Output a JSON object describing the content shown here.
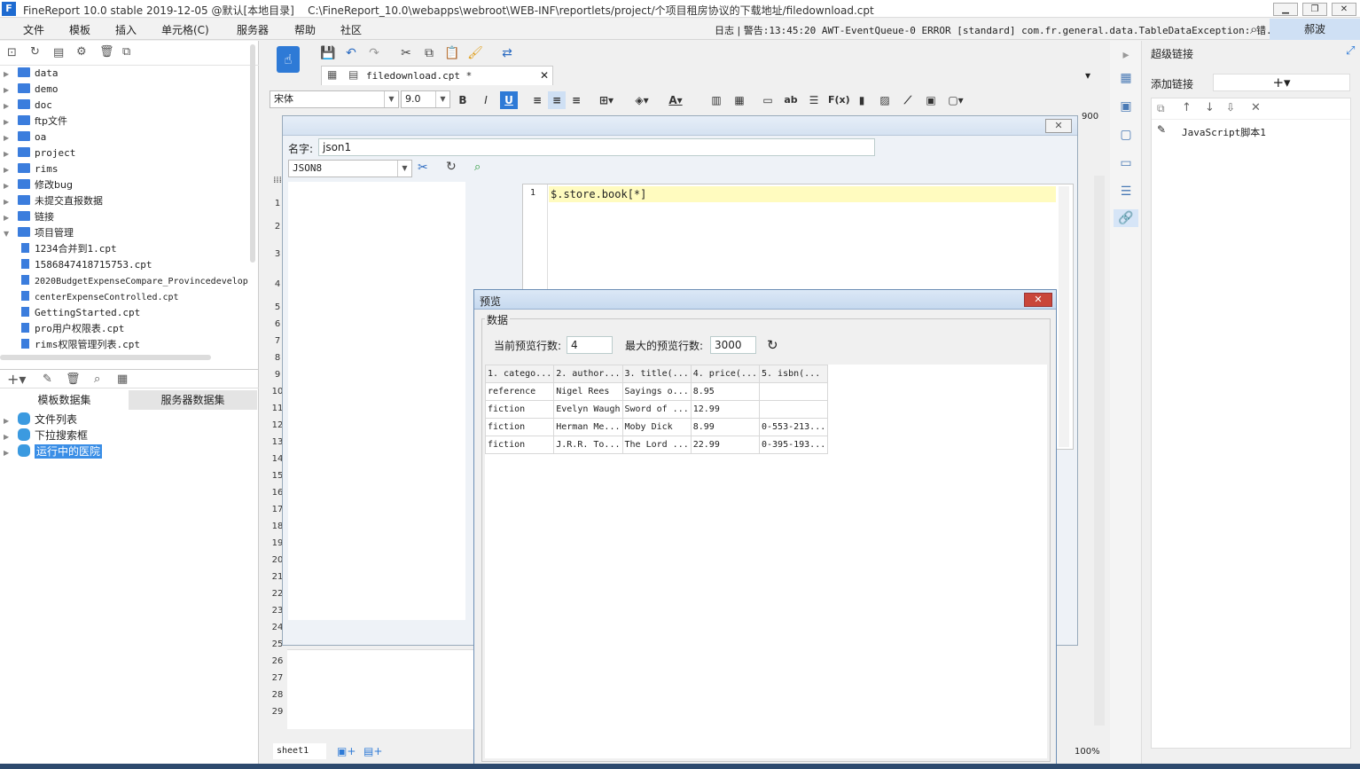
{
  "window": {
    "title": "FineReport 10.0 stable 2019-12-05 @默认[本地目录]",
    "path": "C:\\FineReport_10.0\\webapps\\webroot\\WEB-INF\\reportlets/project/个项目租房协议的下载地址/filedownload.cpt",
    "controls": [
      "▁",
      "❐",
      "✕"
    ]
  },
  "menu": {
    "items": [
      "文件",
      "模板",
      "插入",
      "单元格(C)",
      "服务器",
      "帮助",
      "社区"
    ],
    "log_label": "日志",
    "warning_text": "警告:13:45:20 AWT-EventQueue-0 ERROR [standard] com.fr.general.data.TableDataException: 错...",
    "user": "郝波"
  },
  "tree": {
    "folders": [
      "data",
      "demo",
      "doc",
      "ftp文件",
      "oa",
      "project",
      "rims",
      "修改bug",
      "未提交直报数据",
      "链接",
      "项目管理"
    ],
    "files": [
      "1234合并到1.cpt",
      "1586847418715753.cpt",
      "2020BudgetExpenseCompare_Provincedevelop",
      "centerExpenseControlled.cpt",
      "GettingStarted.cpt",
      "pro用户权限表.cpt",
      "rims权限管理列表.cpt"
    ]
  },
  "dataset_tabs": {
    "template": "模板数据集",
    "server": "服务器数据集"
  },
  "datasets": [
    "文件列表",
    "下拉搜索框",
    "运行中的医院"
  ],
  "editor": {
    "tab_name": "filedownload.cpt *",
    "font_name": "宋体",
    "font_size": "9.0",
    "ruler_900": "900",
    "row_numbers": [
      "1",
      "2",
      "3",
      "4",
      "5",
      "6",
      "7",
      "8",
      "9",
      "10",
      "11",
      "12",
      "13",
      "14",
      "15",
      "16",
      "17",
      "18",
      "19",
      "20",
      "21",
      "22",
      "23",
      "24",
      "25",
      "26",
      "27",
      "28",
      "29"
    ],
    "sheet_name": "sheet1",
    "zoom": "100%"
  },
  "json_dialog": {
    "name_label": "名字:",
    "name_value": "json1",
    "source_select": "JSON8",
    "line_no": "1",
    "code": "$.store.book[*]"
  },
  "preview": {
    "title": "预览",
    "group": "数据",
    "current_rows_label": "当前预览行数:",
    "current_rows": "4",
    "max_rows_label": "最大的预览行数:",
    "max_rows": "3000",
    "columns": [
      "1. catego...",
      "2. author...",
      "3. title(...",
      "4. price(...",
      "5. isbn(..."
    ],
    "rows": [
      [
        "reference",
        "Nigel Rees",
        "Sayings o...",
        "8.95",
        ""
      ],
      [
        "fiction",
        "Evelyn Waugh",
        "Sword of ...",
        "12.99",
        ""
      ],
      [
        "fiction",
        "Herman Me...",
        "Moby Dick",
        "8.99",
        "0-553-213..."
      ],
      [
        "fiction",
        "J.R.R. To...",
        "The Lord ...",
        "22.99",
        "0-395-193..."
      ]
    ]
  },
  "hyperlink": {
    "title": "超级链接",
    "add_label": "添加链接",
    "item": "JavaScript脚本1"
  }
}
